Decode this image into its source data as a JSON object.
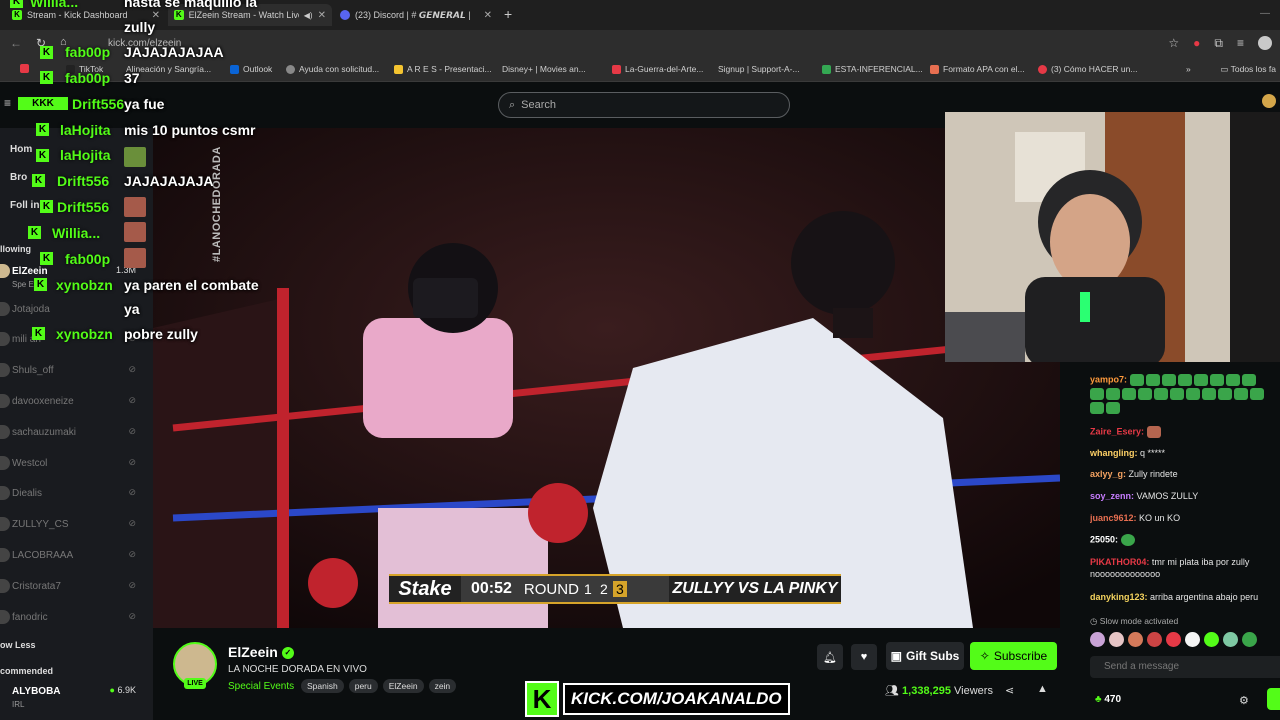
{
  "browser": {
    "tabs": [
      {
        "label": "Stream - Kick Dashboard"
      },
      {
        "label": "ElZeein Stream - Watch Live"
      },
      {
        "label": "(23) Discord | # 𝙂𝙀𝙉𝙀𝙍𝘼𝙇 | "
      }
    ],
    "url": "kick.com/elzeein",
    "bookmarks": [
      {
        "label": "TikTok"
      },
      {
        "label": "Alineación y Sangría..."
      },
      {
        "label": "Outlook"
      },
      {
        "label": "Ayuda con solicitud..."
      },
      {
        "label": "A R E S - Presentaci..."
      },
      {
        "label": "Disney+ | Movies an..."
      },
      {
        "label": "La-Guerra-del-Arte..."
      },
      {
        "label": "Signup | Support-A-..."
      },
      {
        "label": "ESTA-INFERENCIAL..."
      },
      {
        "label": "Formato APA con el..."
      },
      {
        "label": "(3) Cómo HACER un..."
      }
    ],
    "all_bookmarks": "Todos los fa",
    "accent": "#53fc18"
  },
  "kick": {
    "search_placeholder": "Search"
  },
  "sidebar": {
    "nav": [
      "Hom",
      "Bro",
      "Foll   ing"
    ],
    "following_label": "llowing",
    "channels": [
      {
        "name": "ElZeein",
        "value": "1.3M"
      },
      {
        "name": "Spe    Eve"
      },
      {
        "name": "Jotajoda"
      },
      {
        "name": "mili    an"
      },
      {
        "name": "Shuls_off"
      },
      {
        "name": "davooxeneize"
      },
      {
        "name": "sachauzumaki"
      },
      {
        "name": "Westcol"
      },
      {
        "name": "Diealis"
      },
      {
        "name": "ZULLYY_CS"
      },
      {
        "name": "LACOBRAAA"
      },
      {
        "name": "Cristorata7"
      },
      {
        "name": "fanodric"
      }
    ],
    "show_less": "ow Less",
    "recommended_label": "commended",
    "recommended": [
      {
        "name": "ALYBOBA",
        "sub": "IRL",
        "value": "6.9K"
      }
    ]
  },
  "overlay_chat": [
    {
      "user": "Willia...",
      "msg": "hasta se maquillo la"
    },
    {
      "user": "",
      "msg": "zully"
    },
    {
      "user": "fab00p",
      "msg": "JAJAJAJAJAA"
    },
    {
      "user": "fab00p",
      "msg": "37"
    },
    {
      "user": "Drift556",
      "msg": "ya fue"
    },
    {
      "user": "laHojita",
      "msg": "mis 10 puntos csmr"
    },
    {
      "user": "laHojita",
      "msg": ""
    },
    {
      "user": "Drift556",
      "msg": "JAJAJAJAJA"
    },
    {
      "user": "Drift556",
      "msg": ""
    },
    {
      "user": "Willia...",
      "msg": ""
    },
    {
      "user": "fab00p",
      "msg": ""
    },
    {
      "user": "xynobzn",
      "msg": "ya paren el combate"
    },
    {
      "user": "",
      "msg": "ya"
    },
    {
      "user": "xynobzn",
      "msg": "pobre zully"
    }
  ],
  "video": {
    "hashtag": "#LANOCHEDORADA",
    "score": {
      "sponsor": "Stake",
      "time": "00:52",
      "round_label": "ROUND",
      "rounds": [
        "1",
        "2",
        "3"
      ],
      "current_round": 3,
      "match": "ZULLYY VS LA PINKY"
    }
  },
  "chat": {
    "messages": [
      {
        "user": "yampo7:",
        "text": "",
        "color": "#ff9a3c"
      },
      {
        "user": "Zaire_Esery:",
        "text": "",
        "color": "#e63946"
      },
      {
        "user": "whangling:",
        "text": "q *****",
        "color": "#ffd166"
      },
      {
        "user": "axlyy_g:",
        "text": "Zully rindete",
        "color": "#f4a261"
      },
      {
        "user": "soy_zenn:",
        "text": "VAMOS ZULLY",
        "color": "#c77dff"
      },
      {
        "user": "juanc9612:",
        "text": "KO un KO",
        "color": "#e76f51"
      },
      {
        "user": "25050:",
        "text": "",
        "color": "#ffffff"
      },
      {
        "user": "PIKATHOR04:",
        "text": "tmr mi plata iba por zully nooooooooooooo",
        "color": "#e63946"
      },
      {
        "user": "danyking123:",
        "text": "arriba argentina abajo peru",
        "color": "#f4d35e"
      }
    ],
    "slow_mode": "Slow mode activated",
    "input_placeholder": "Send a message",
    "points": "470"
  },
  "channel": {
    "name": "ElZeein",
    "live": "LIVE",
    "title": "LA NOCHE DORADA EN VIVO",
    "category": "Special Events",
    "tags": [
      "Spanish",
      "peru",
      "ElZeein",
      "zein"
    ],
    "gift_label": "Gift Subs",
    "subscribe_label": "Subscribe",
    "viewers_count": "1,338,295",
    "viewers_label": "Viewers"
  },
  "watermark": "KICK.COM/JOAKANALDO"
}
